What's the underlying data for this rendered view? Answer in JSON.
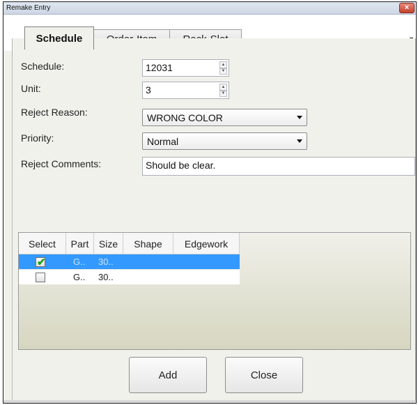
{
  "window": {
    "title": "Remake Entry",
    "close_glyph": "×"
  },
  "tabs": [
    {
      "label": "Schedule"
    },
    {
      "label": "Order-Item"
    },
    {
      "label": "Rack-Slot"
    }
  ],
  "form": {
    "schedule": {
      "label": "Schedule:",
      "value": "12031"
    },
    "unit": {
      "label": "Unit:",
      "value": "3"
    },
    "reject_reason": {
      "label": "Reject Reason:",
      "value": "WRONG COLOR"
    },
    "priority": {
      "label": "Priority:",
      "value": "Normal"
    },
    "reject_comments": {
      "label": "Reject Comments:",
      "value": "Should be clear."
    }
  },
  "grid": {
    "columns": [
      "Select",
      "Part",
      "Size",
      "Shape",
      "Edgework"
    ],
    "rows": [
      {
        "checked": true,
        "part": "G..",
        "size": "30..",
        "shape": "",
        "edgework": ""
      },
      {
        "checked": false,
        "part": "G..",
        "size": "30..",
        "shape": "",
        "edgework": ""
      }
    ]
  },
  "buttons": {
    "add": "Add",
    "close": "Close"
  },
  "icons": {
    "checkbox_checked": "checkmark-icon",
    "tab_overflow": "chevron-down-icon"
  }
}
